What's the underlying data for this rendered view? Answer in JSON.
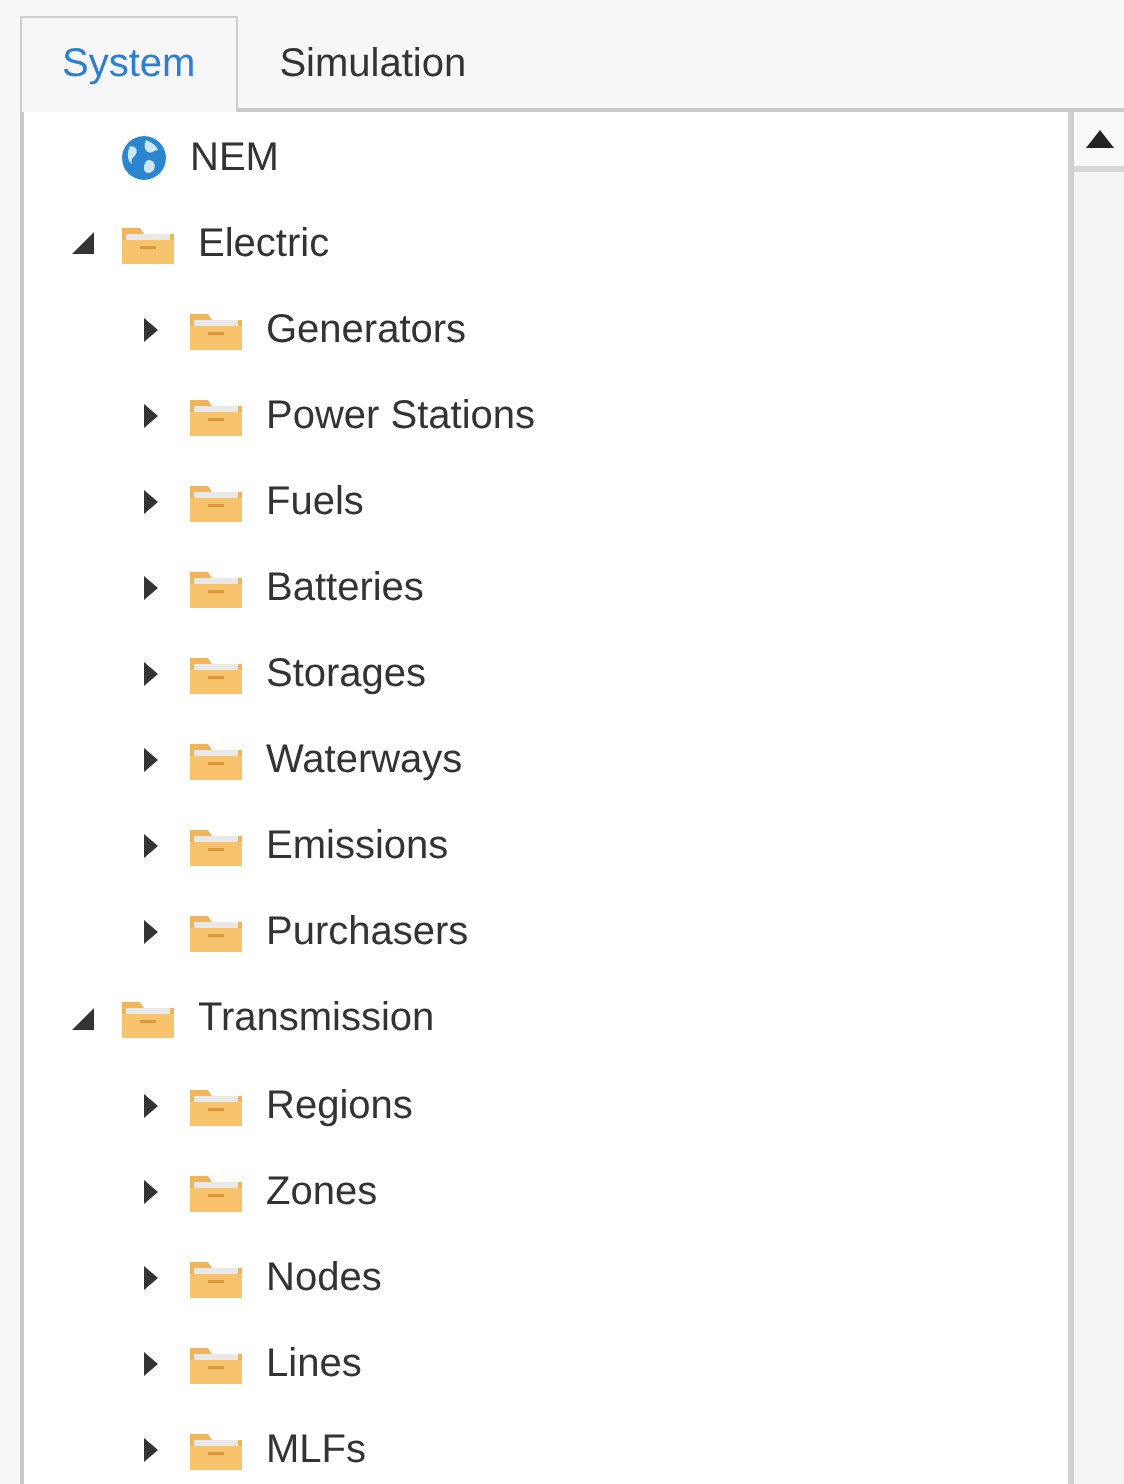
{
  "tabs": [
    {
      "label": "System",
      "selected": true
    },
    {
      "label": "Simulation",
      "selected": false
    }
  ],
  "tree": [
    {
      "label": "NEM",
      "kind": "globe"
    },
    {
      "label": "Electric",
      "kind": "folder",
      "expanded": true,
      "children": [
        {
          "label": "Generators",
          "kind": "folder",
          "expanded": false
        },
        {
          "label": "Power Stations",
          "kind": "folder",
          "expanded": false
        },
        {
          "label": "Fuels",
          "kind": "folder",
          "expanded": false
        },
        {
          "label": "Batteries",
          "kind": "folder",
          "expanded": false
        },
        {
          "label": "Storages",
          "kind": "folder",
          "expanded": false
        },
        {
          "label": "Waterways",
          "kind": "folder",
          "expanded": false
        },
        {
          "label": "Emissions",
          "kind": "folder",
          "expanded": false
        },
        {
          "label": "Purchasers",
          "kind": "folder",
          "expanded": false
        }
      ]
    },
    {
      "label": "Transmission",
      "kind": "folder",
      "expanded": true,
      "children": [
        {
          "label": "Regions",
          "kind": "folder",
          "expanded": false
        },
        {
          "label": "Zones",
          "kind": "folder",
          "expanded": false
        },
        {
          "label": "Nodes",
          "kind": "folder",
          "expanded": false
        },
        {
          "label": "Lines",
          "kind": "folder",
          "expanded": false
        },
        {
          "label": "MLFs",
          "kind": "folder",
          "expanded": false
        }
      ]
    }
  ]
}
